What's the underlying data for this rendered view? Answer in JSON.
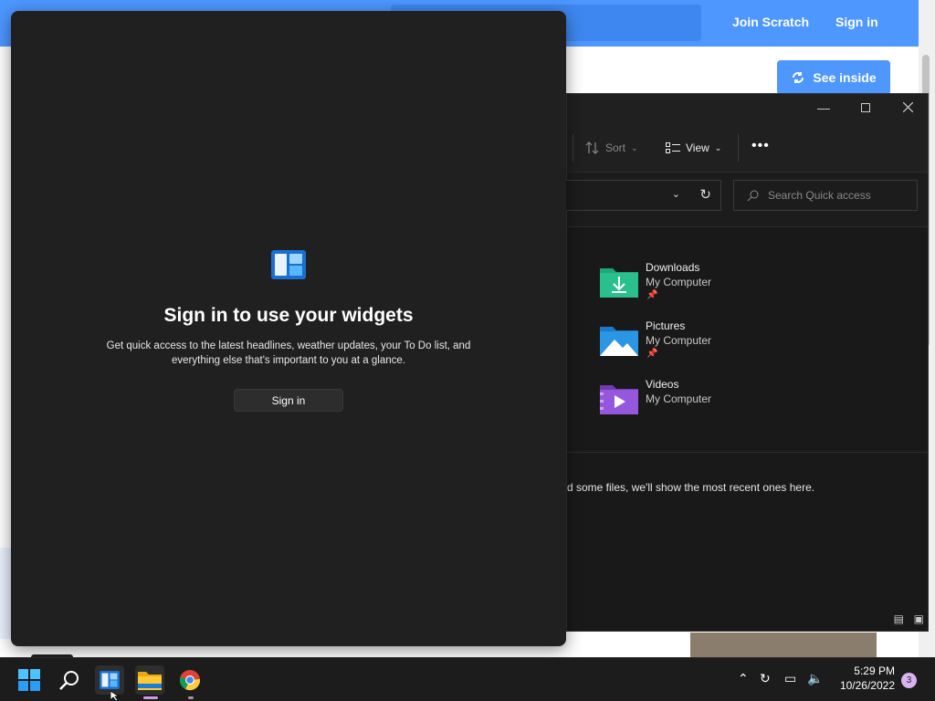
{
  "browser": {
    "join_label": "Join Scratch",
    "signin_label": "Sign in",
    "see_inside_label": "See inside"
  },
  "explorer": {
    "toolbar": {
      "sort_label": "Sort",
      "view_label": "View",
      "more_label": "•••"
    },
    "search_placeholder": "Search Quick access",
    "quick_access": [
      {
        "name": "Downloads",
        "location": "My Computer",
        "pinned": true,
        "icon": "downloads-folder-icon",
        "color": "#1fa67a"
      },
      {
        "name": "Pictures",
        "location": "My Computer",
        "pinned": true,
        "icon": "pictures-folder-icon",
        "color": "#2a8fd8"
      },
      {
        "name": "Videos",
        "location": "My Computer",
        "pinned": false,
        "icon": "videos-folder-icon",
        "color": "#8a4fd1"
      }
    ],
    "recent_empty_message": "d some files, we'll show the most recent ones here."
  },
  "widgets": {
    "heading": "Sign in to use your widgets",
    "description": "Get quick access to the latest headlines, weather updates, your To Do list, and everything else that's important to you at a glance.",
    "signin_label": "Sign in"
  },
  "taskbar": {
    "time": "5:29 PM",
    "date": "10/26/2022",
    "notification_count": "3"
  },
  "colors": {
    "scratch_blue": "#4d97ff",
    "panel_bg": "#202020",
    "taskbar_bg": "#1c1c1c",
    "accent_windows": "#0078d4"
  }
}
